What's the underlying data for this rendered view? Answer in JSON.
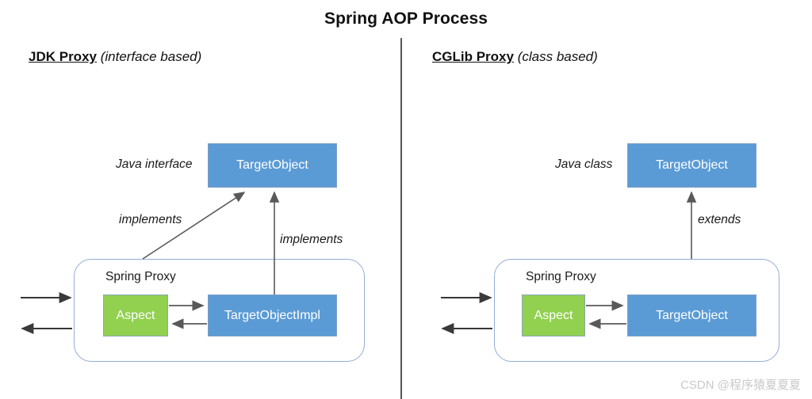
{
  "diagram": {
    "title": "Spring AOP Process",
    "watermark": "CSDN @程序猿夏夏夏",
    "colors": {
      "blue_box": "#5B9BD5",
      "green_box": "#92D050",
      "container_border": "#93ADD4",
      "divider": "#555555",
      "arrow": "#595959",
      "text_dark": "#111111",
      "watermark": "#c9c9c9"
    },
    "panels": [
      {
        "id": "jdk",
        "heading_strong": "JDK Proxy",
        "heading_italic": "(interface based)",
        "type_label": "Java interface",
        "top_box": "TargetObject",
        "container_label": "Spring Proxy",
        "aspect_box": "Aspect",
        "target_box": "TargetObjectImpl",
        "relation_labels": [
          "implements",
          "implements"
        ]
      },
      {
        "id": "cglib",
        "heading_strong": "CGLib Proxy",
        "heading_italic": "(class based)",
        "type_label": "Java class",
        "top_box": "TargetObject",
        "container_label": "Spring Proxy",
        "aspect_box": "Aspect",
        "target_box": "TargetObject",
        "relation_labels": [
          "extends"
        ]
      }
    ]
  }
}
